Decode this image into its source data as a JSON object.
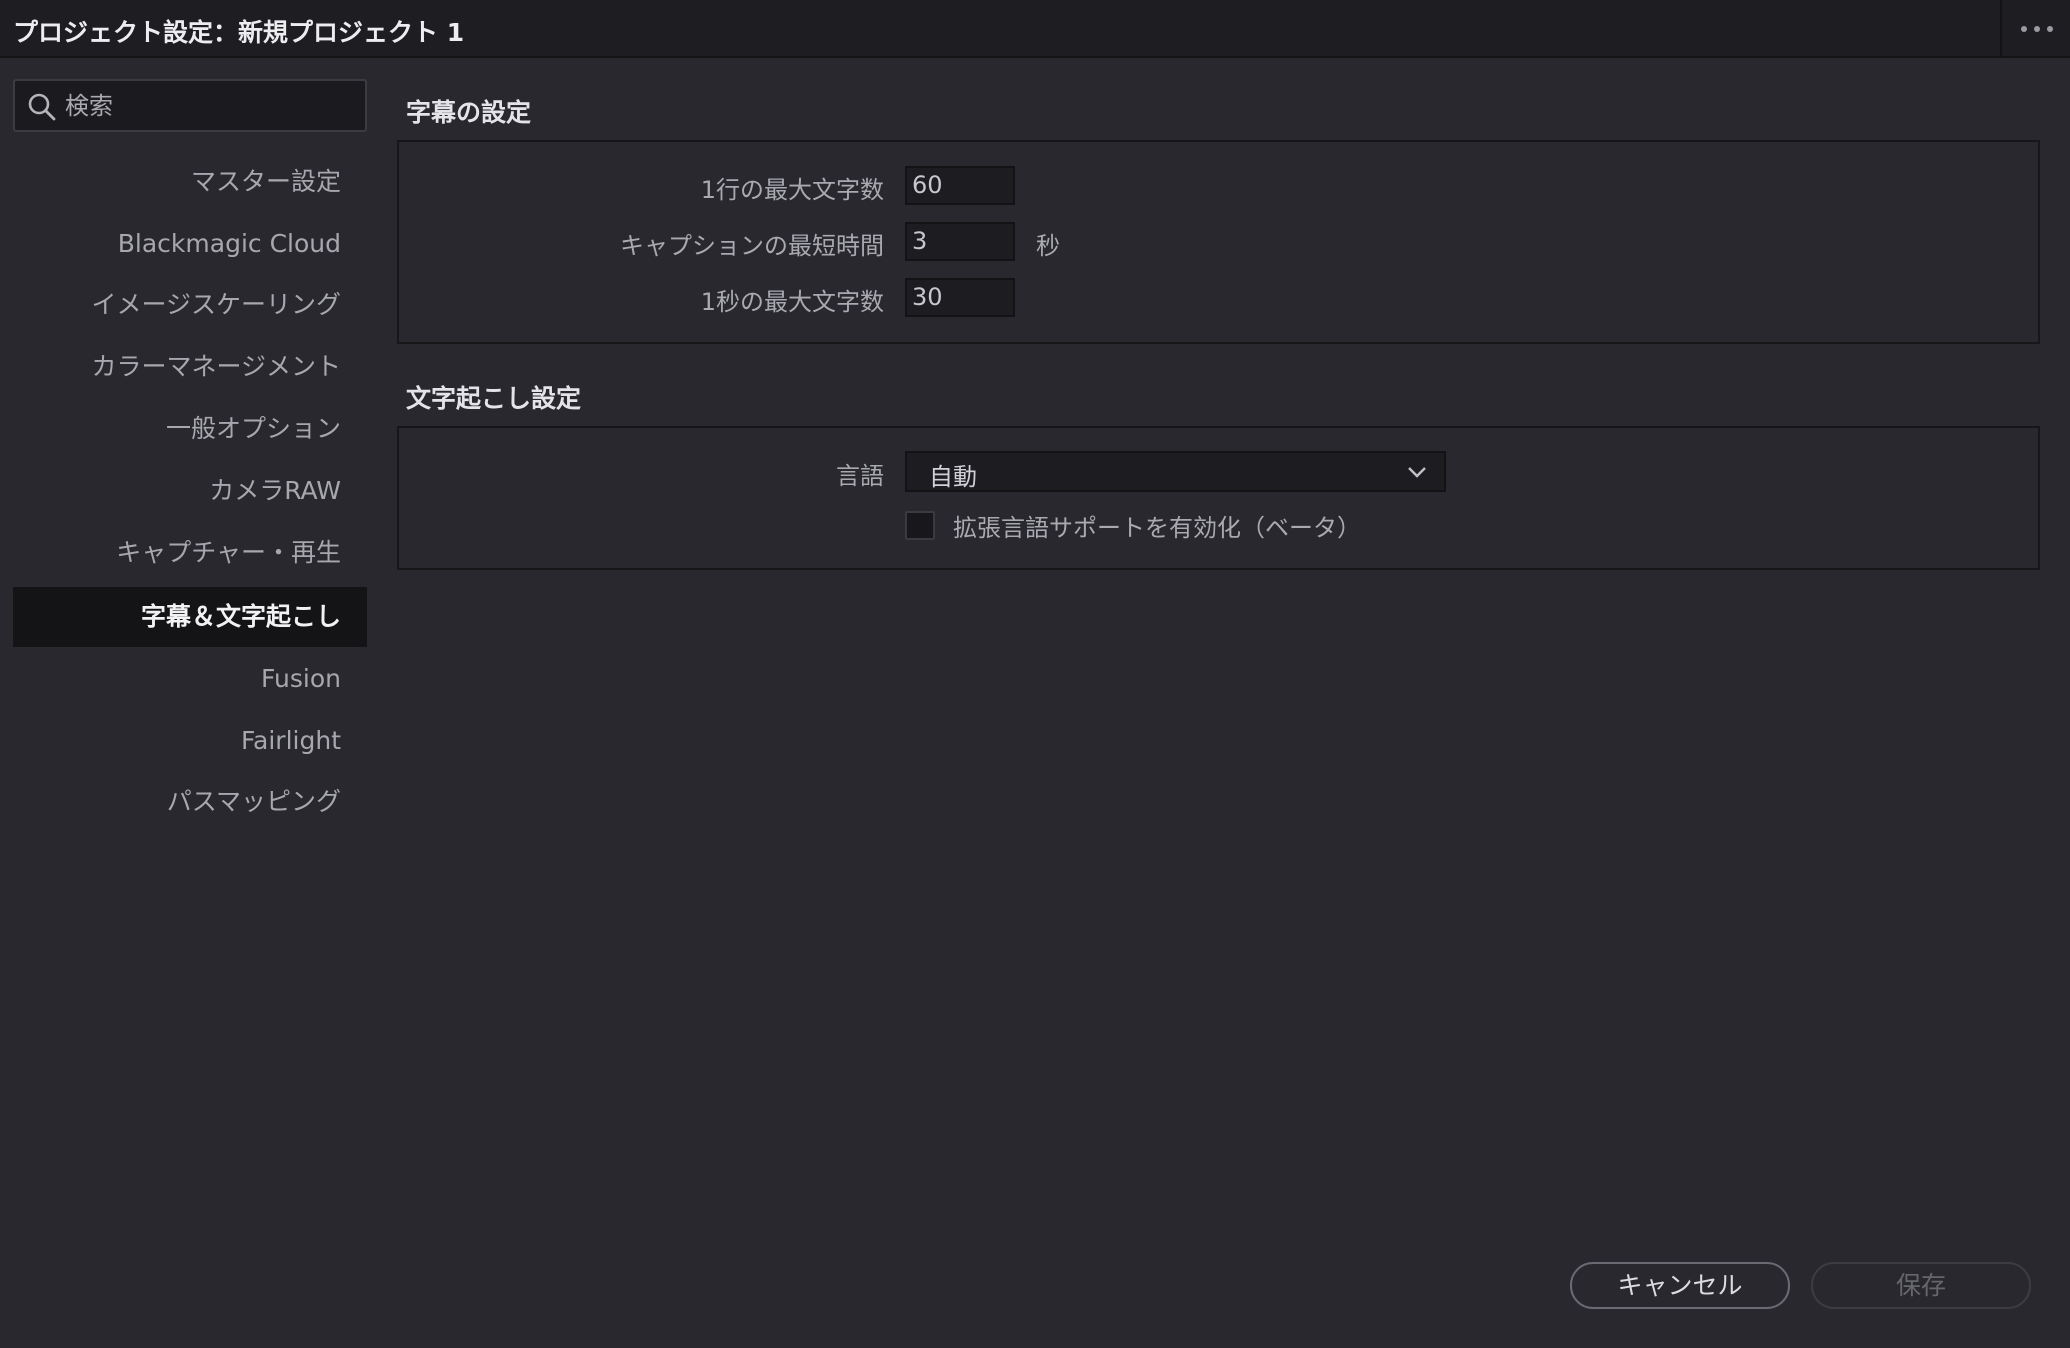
{
  "window": {
    "title": "プロジェクト設定：新規プロジェクト 1",
    "more_icon": "more-horizontal-icon"
  },
  "search": {
    "placeholder": "検索",
    "value": "",
    "icon": "search-icon"
  },
  "sidebar": {
    "items": [
      {
        "label": "マスター設定",
        "active": false
      },
      {
        "label": "Blackmagic Cloud",
        "active": false
      },
      {
        "label": "イメージスケーリング",
        "active": false
      },
      {
        "label": "カラーマネージメント",
        "active": false
      },
      {
        "label": "一般オプション",
        "active": false
      },
      {
        "label": "カメラRAW",
        "active": false
      },
      {
        "label": "キャプチャー・再生",
        "active": false
      },
      {
        "label": "字幕＆文字起こし",
        "active": true
      },
      {
        "label": "Fusion",
        "active": false
      },
      {
        "label": "Fairlight",
        "active": false
      },
      {
        "label": "パスマッピング",
        "active": false
      }
    ]
  },
  "subtitles": {
    "title": "字幕の設定",
    "fields": [
      {
        "label": "1行の最大文字数",
        "value": "60",
        "unit": ""
      },
      {
        "label": "キャプションの最短時間",
        "value": "3",
        "unit": "秒"
      },
      {
        "label": "1秒の最大文字数",
        "value": "30",
        "unit": ""
      }
    ]
  },
  "transcription": {
    "title": "文字起こし設定",
    "language_label": "言語",
    "language_value": "自動",
    "extended_support_label": "拡張言語サポートを有効化（ベータ）",
    "extended_support_checked": false
  },
  "footer": {
    "cancel_label": "キャンセル",
    "save_label": "保存",
    "save_enabled": false
  },
  "colors": {
    "background": "#28282e",
    "titlebar": "#1e1e22",
    "active_item": "#141417",
    "input": "#1d1d21"
  }
}
